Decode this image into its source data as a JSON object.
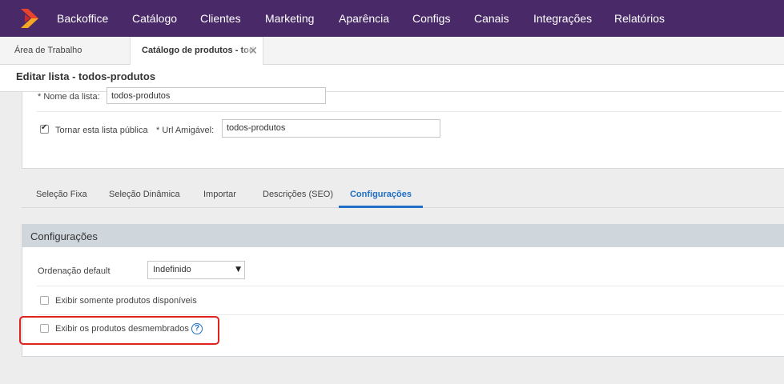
{
  "nav": {
    "items": [
      "Backoffice",
      "Catálogo",
      "Clientes",
      "Marketing",
      "Aparência",
      "Configs",
      "Canais",
      "Integrações",
      "Relatórios"
    ],
    "logo_icon": "brand-logo-icon",
    "logo_colors": [
      "#e8432c",
      "#f5a623"
    ],
    "background": "#492968"
  },
  "window_tabs": [
    {
      "label": "Área de Trabalho",
      "active": false
    },
    {
      "label": "Catálogo de produtos - todos-produtos",
      "active": true,
      "close": "✕"
    }
  ],
  "page": {
    "title": "Editar lista - todos-produtos"
  },
  "form": {
    "nome_label": "* Nome da lista:",
    "nome_value": "todos-produtos",
    "publica_label": "Tornar esta lista pública",
    "publica_checked": true,
    "url_label": "* Url Amigável:",
    "url_value": "todos-produtos"
  },
  "content_tabs": [
    "Seleção Fixa",
    "Seleção Dinâmica",
    "Importar",
    "Descrições (SEO)",
    "Configurações"
  ],
  "active_content_tab": "Configurações",
  "config": {
    "title": "Configurações",
    "ordenacao_label": "Ordenação default",
    "ordenacao_value": "Indefinido",
    "disponiveis_label": "Exibir somente produtos disponíveis",
    "disponiveis_checked": false,
    "desmembrados_label": "Exibir os produtos desmembrados",
    "desmembrados_checked": false,
    "help_glyph": "?"
  },
  "colors": {
    "accent": "#1f6fc5",
    "highlight": "#e0231e",
    "panel_header": "#cfd6dc"
  }
}
